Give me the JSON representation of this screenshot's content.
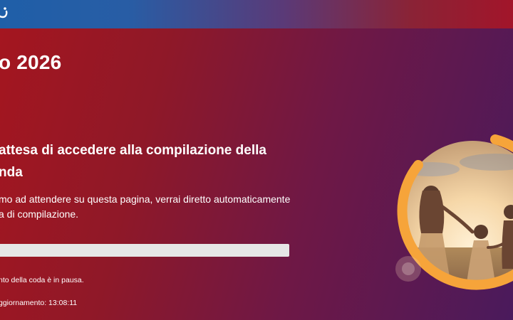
{
  "header": {
    "logo_icon": "circular-smile-logo-icon"
  },
  "page": {
    "title": "o 2026",
    "heading_line1": "attesa di accedere alla compilazione della",
    "heading_line2": "nda",
    "description_line1": "mo ad attendere su questa pagina, verrai diretto automaticamente",
    "description_line2": "a di compilazione.",
    "queue_status": "nto della coda è in pausa.",
    "last_update": "ggiornamento: 13:08:11",
    "progress_fraction": 0
  },
  "illustration": {
    "description_icon": "family-sunset-photo",
    "ring_color": "#f6a43a"
  },
  "colors": {
    "background_start": "#a5161f",
    "background_end": "#4a1a5c",
    "topbar_blue": "#1f5fa8",
    "progress_track": "#e6e6e6"
  }
}
